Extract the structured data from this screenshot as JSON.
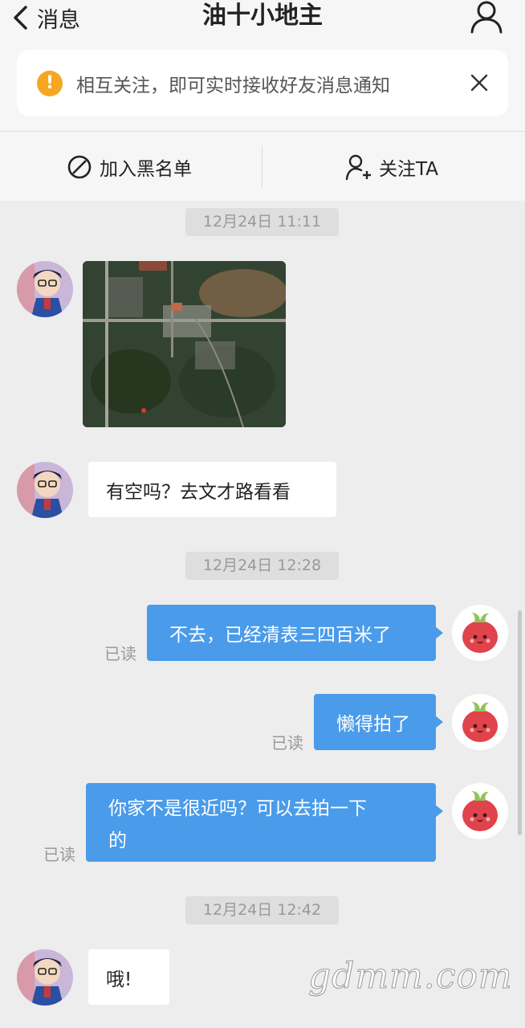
{
  "header": {
    "back_label": "消息",
    "title": "油十小地主"
  },
  "notice": {
    "text": "相互关注，即可实时接收好友消息通知"
  },
  "actions": {
    "blacklist_label": "加入黑名单",
    "follow_label": "关注TA"
  },
  "messages": {
    "ts1": "12月24日 11:11",
    "incoming_1_text": "有空吗？去文才路看看",
    "ts2": "12月24日 12:28",
    "out_1_text": "不去，已经清表三四百米了",
    "out_2_text": "懒得拍了",
    "out_3_line1": "你家不是很近吗？可以去拍一下",
    "out_3_line2": "的",
    "read_label": "已读",
    "ts3": "12月24日 12:42",
    "incoming_2_text": "哦!"
  },
  "watermark": "gdmm.com",
  "colors": {
    "outgoing_bubble": "#4a9bea",
    "warning": "#f5a623"
  }
}
